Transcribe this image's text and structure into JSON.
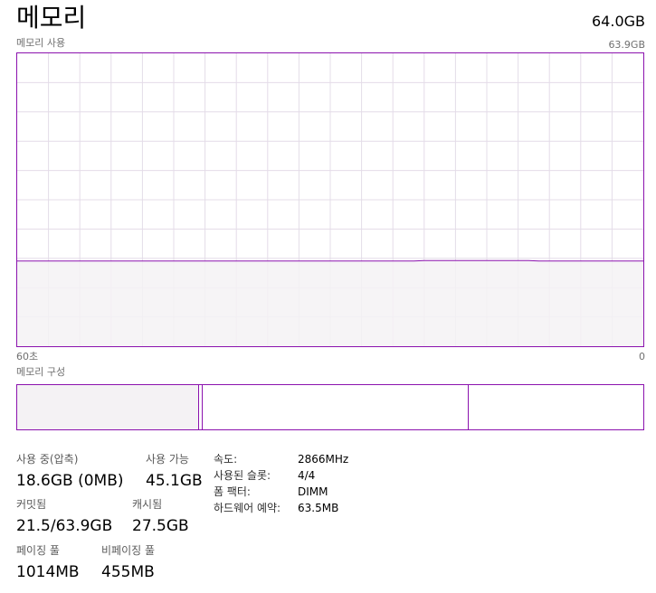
{
  "header": {
    "title": "메모리",
    "total": "64.0GB"
  },
  "usage_graph": {
    "label": "메모리 사용",
    "max_label": "63.9GB",
    "time_left": "60초",
    "time_right": "0",
    "max_gb": 63.9,
    "usage_gb": [
      18.6,
      18.6,
      18.6,
      18.6,
      18.6,
      18.6,
      18.6,
      18.6,
      18.6,
      18.6,
      18.6,
      18.6,
      18.6,
      18.6,
      18.6,
      18.6,
      18.6,
      18.6,
      18.6,
      18.6,
      18.6,
      18.6,
      18.6,
      18.6,
      18.6,
      18.6,
      18.6,
      18.6,
      18.6,
      18.6,
      18.6,
      18.6,
      18.6,
      18.6,
      18.6,
      18.6,
      18.6,
      18.6,
      18.6,
      18.7,
      18.7,
      18.7,
      18.7,
      18.7,
      18.7,
      18.7,
      18.7,
      18.7,
      18.7,
      18.7,
      18.6,
      18.6,
      18.6,
      18.6,
      18.6,
      18.6,
      18.6,
      18.6,
      18.6,
      18.6,
      18.6
    ],
    "line_color": "#8b12ae",
    "fill_color": "#f4f2f4",
    "grid_color": "#e4dce8"
  },
  "composition": {
    "label": "메모리 구성",
    "segments": [
      {
        "name": "in-use",
        "gb": 18.6,
        "fill": "#f4f2f4"
      },
      {
        "name": "modified",
        "gb": 0.3,
        "fill": "#ffffff"
      },
      {
        "name": "standby",
        "gb": 27.2,
        "fill": "#ffffff"
      },
      {
        "name": "free",
        "gb": 17.8,
        "fill": "#ffffff"
      }
    ]
  },
  "stats": {
    "in_use_label": "사용 중(압축)",
    "in_use_value": "18.6GB (0MB)",
    "available_label": "사용 가능",
    "available_value": "45.1GB",
    "committed_label": "커밋됨",
    "committed_value": "21.5/63.9GB",
    "cached_label": "캐시됨",
    "cached_value": "27.5GB",
    "paged_label": "페이징 풀",
    "paged_value": "1014MB",
    "nonpaged_label": "비페이징 풀",
    "nonpaged_value": "455MB"
  },
  "details": [
    {
      "label": "속도:",
      "value": "2866MHz"
    },
    {
      "label": "사용된 슬롯:",
      "value": "4/4"
    },
    {
      "label": "폼 팩터:",
      "value": "DIMM"
    },
    {
      "label": "하드웨어 예약:",
      "value": "63.5MB"
    }
  ]
}
